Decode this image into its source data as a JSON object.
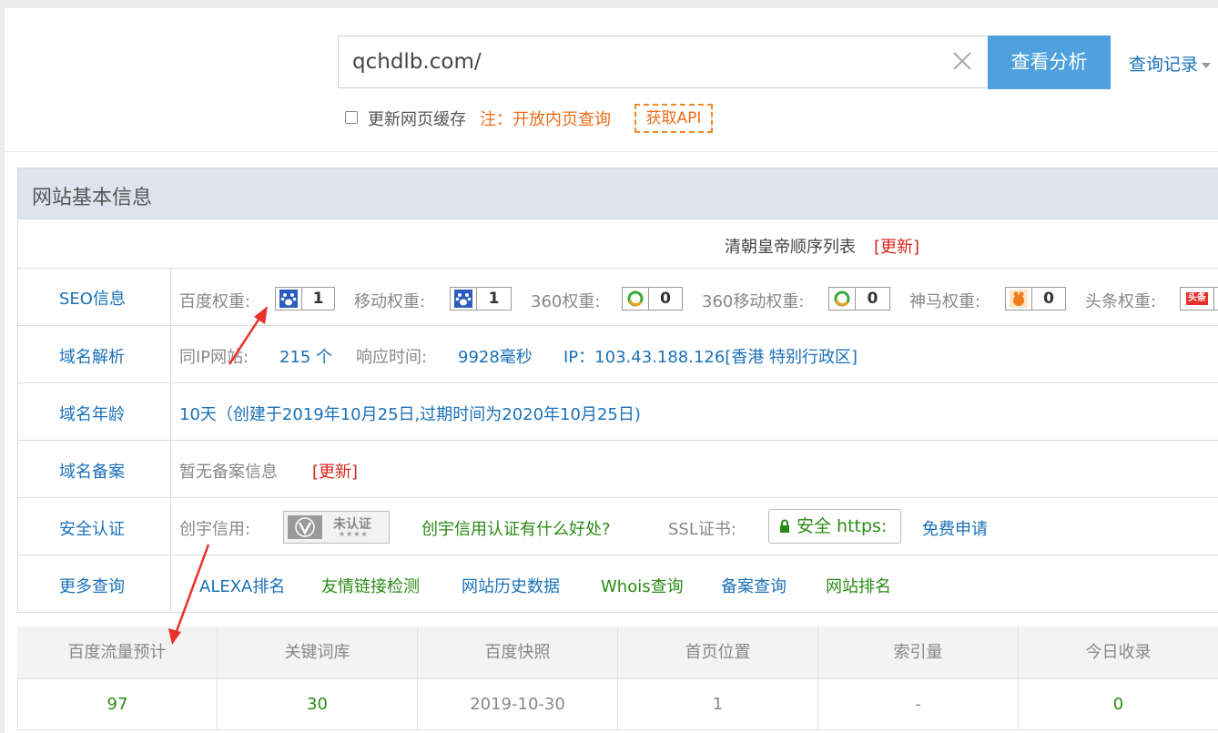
{
  "search": {
    "value": "qchdlb.com/",
    "button_label": "查看分析",
    "history_label": "查询记录",
    "cache_label": "更新网页缓存",
    "notice": "注：开放内页查询",
    "api_label": "获取API"
  },
  "basic_info": {
    "title": "网站基本信息",
    "site_title": "清朝皇帝顺序列表",
    "update_link": "[更新]"
  },
  "rows": {
    "seo": {
      "label": "SEO信息",
      "items": [
        {
          "name": "百度权重:",
          "value": "1",
          "icon": "baidu-paw-icon"
        },
        {
          "name": "移动权重:",
          "value": "1",
          "icon": "baidu-paw-icon"
        },
        {
          "name": "360权重:",
          "value": "0",
          "icon": "360-icon"
        },
        {
          "name": "360移动权重:",
          "value": "0",
          "icon": "360-icon"
        },
        {
          "name": "神马权重:",
          "value": "0",
          "icon": "shenma-icon"
        },
        {
          "name": "头条权重:",
          "value": "",
          "icon": "toutiao-icon"
        }
      ],
      "toutiao_icon_text": "头条"
    },
    "dns": {
      "label": "域名解析",
      "same_ip_label": "同IP网站:",
      "same_ip_value": "215 个",
      "response_label": "响应时间:",
      "response_value": "9928毫秒",
      "ip_text": "IP：103.43.188.126[香港 特别行政区]"
    },
    "age": {
      "label": "域名年龄",
      "value": "10天（创建于2019年10月25日,过期时间为2020年10月25日)"
    },
    "icp": {
      "label": "域名备案",
      "value": "暂无备案信息",
      "update_link": "[更新]"
    },
    "security": {
      "label": "安全认证",
      "chuangyu_label": "创宇信用:",
      "chuangyu_badge": "未认证",
      "chuangyu_stars": "★★★★",
      "chuangyu_link": "创宇信用认证有什么好处?",
      "ssl_label": "SSL证书:",
      "ssl_badge": "安全 https:",
      "ssl_link": "免费申请"
    },
    "more": {
      "label": "更多查询",
      "links": [
        {
          "text": "ALEXA排名",
          "color": "#1b71b8"
        },
        {
          "text": "友情链接检测",
          "color": "#2b8a16"
        },
        {
          "text": "网站历史数据",
          "color": "#1b71b8"
        },
        {
          "text": "Whois查询",
          "color": "#2b8a16"
        },
        {
          "text": "备案查询",
          "color": "#1b71b8"
        },
        {
          "text": "网站排名",
          "color": "#2b8a16"
        }
      ]
    }
  },
  "stats": {
    "headers": [
      "百度流量预计",
      "关键词库",
      "百度快照",
      "首页位置",
      "索引量",
      "今日收录"
    ],
    "values": [
      "97",
      "30",
      "2019-10-30",
      "1",
      "-",
      "0"
    ],
    "value_colors": [
      "#2b8a16",
      "#2b8a16",
      "#888888",
      "#888888",
      "#888888",
      "#2b8a16"
    ]
  },
  "colors": {
    "accent": "#4ea1dc",
    "link_blue": "#1b71b8",
    "link_green": "#2b8a16",
    "warn_orange": "#ef6c1a",
    "annotation_red": "#e8312a"
  }
}
